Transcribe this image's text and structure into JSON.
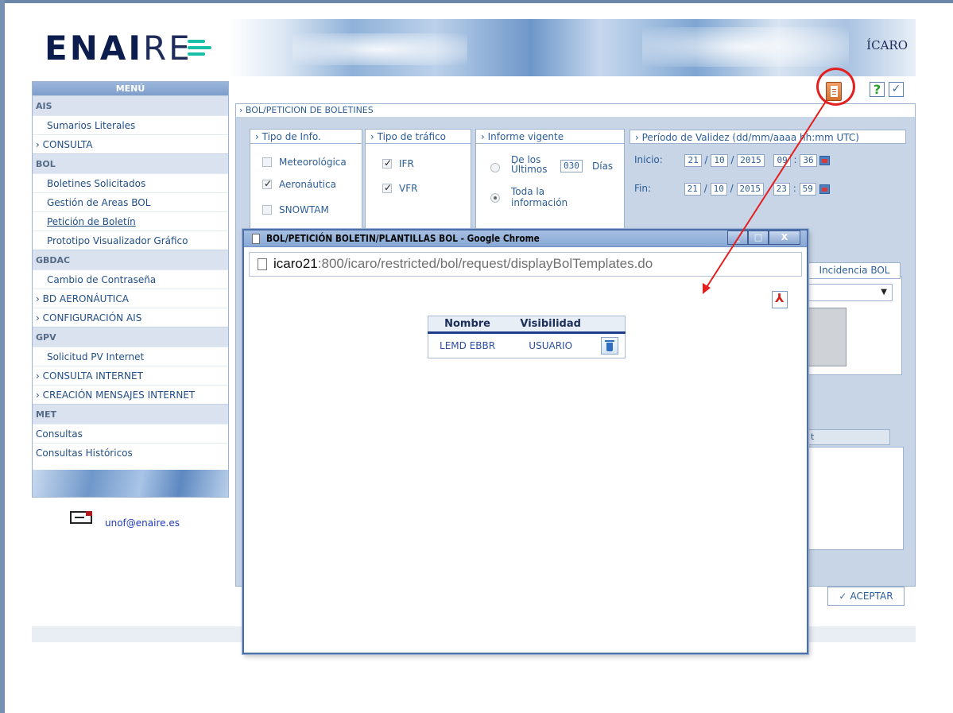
{
  "header": {
    "logo_strong": "ENAI",
    "logo_thin": "RE",
    "brand_right": "ÍCARO"
  },
  "menu": {
    "title": "MENÚ",
    "sections": [
      {
        "label": "AIS",
        "items": [
          {
            "label": "Sumarios Literales",
            "type": "link"
          },
          {
            "label": "CONSULTA",
            "type": "expand"
          }
        ]
      },
      {
        "label": "BOL",
        "items": [
          {
            "label": "Boletines Solicitados",
            "type": "link"
          },
          {
            "label": "Gestión de Areas BOL",
            "type": "link"
          },
          {
            "label": "Petición de Boletín",
            "type": "current"
          },
          {
            "label": "Prototipo Visualizador Gráfico",
            "type": "link"
          }
        ]
      },
      {
        "label": "GBDAC",
        "items": [
          {
            "label": "Cambio de Contraseña",
            "type": "link"
          },
          {
            "label": "BD AERONÁUTICA",
            "type": "expand"
          },
          {
            "label": "CONFIGURACIÓN AIS",
            "type": "expand"
          }
        ]
      },
      {
        "label": "GPV",
        "items": [
          {
            "label": "Solicitud PV Internet",
            "type": "link"
          },
          {
            "label": "CONSULTA INTERNET",
            "type": "expand"
          },
          {
            "label": "CREACIÓN MENSAJES INTERNET",
            "type": "expand"
          }
        ]
      },
      {
        "label": "MET",
        "items": [
          {
            "label": "Consultas",
            "type": "link"
          },
          {
            "label": "Consultas Históricos",
            "type": "link"
          }
        ]
      }
    ],
    "email": "unof@enaire.es"
  },
  "main": {
    "title": "BOL/PETICION DE BOLETINES",
    "tipo_info": {
      "legend": "Tipo de Info.",
      "options": [
        {
          "label": "Meteorológica",
          "checked": false
        },
        {
          "label": "Aeronáutica",
          "checked": true
        },
        {
          "label": "SNOWTAM",
          "checked": false
        }
      ]
    },
    "tipo_trafico": {
      "legend": "Tipo de tráfico",
      "options": [
        {
          "label": "IFR",
          "checked": true
        },
        {
          "label": "VFR",
          "checked": true
        }
      ]
    },
    "informe": {
      "legend": "Informe vigente",
      "ultimos_label_1": "De los",
      "ultimos_label_2": "Últimos",
      "ultimos_value": "030",
      "ultimos_unit": "Días",
      "toda_label_1": "Toda la",
      "toda_label_2": "información"
    },
    "periodo": {
      "legend": "Período de Validez (dd/mm/aaaa hh:mm UTC)",
      "inicio_label": "Inicio:",
      "inicio": {
        "dd": "21",
        "mm": "10",
        "yyyy": "2015",
        "hh": "09",
        "mi": "36"
      },
      "fin_label": "Fin:",
      "fin": {
        "dd": "21",
        "mm": "10",
        "yyyy": "2015",
        "hh": "23",
        "mi": "59"
      }
    },
    "incidencia_label": "Incidencia BOL",
    "tab_partial": "t",
    "accept_label": "ACEPTAR"
  },
  "toolbar": {
    "help_label": "?",
    "check_label": "✓"
  },
  "popup": {
    "title": "BOL/PETICIÓN BOLETIN/PLANTILLAS BOL - Google Chrome",
    "url_host": "icaro21",
    "url_rest": ":800/icaro/restricted/bol/request/displayBolTemplates.do",
    "minimize": "_",
    "maximize": "□",
    "close": "X",
    "table": {
      "headers": [
        "Nombre",
        "Visibilidad",
        ""
      ],
      "rows": [
        {
          "nombre": "LEMD EBBR",
          "visibilidad": "USUARIO"
        }
      ]
    }
  },
  "colors": {
    "annotation": "#e32020",
    "brand_accent": "#16c0a8",
    "link": "#224f86"
  }
}
